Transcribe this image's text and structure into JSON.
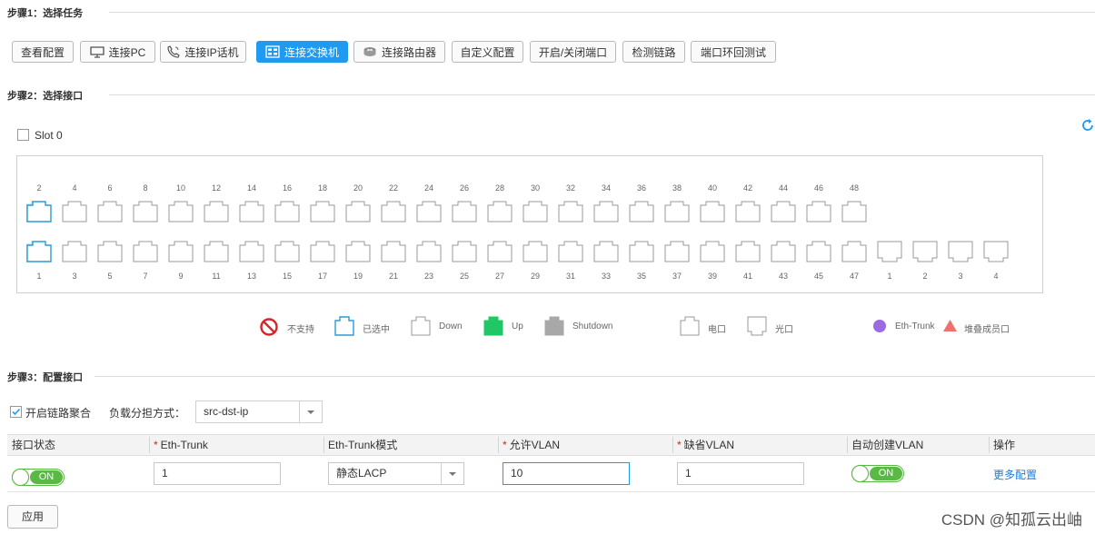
{
  "step1": {
    "title": "步骤1：选择任务",
    "tasks": [
      {
        "label": "查看配置",
        "icon": "",
        "active": false
      },
      {
        "label": "连接PC",
        "icon": "monitor-icon",
        "active": false
      },
      {
        "label": "连接IP话机",
        "icon": "phone-icon",
        "active": false
      },
      {
        "label": "连接交换机",
        "icon": "switch-icon",
        "active": true
      },
      {
        "label": "连接路由器",
        "icon": "router-icon",
        "active": false
      },
      {
        "label": "自定义配置",
        "icon": "",
        "active": false
      },
      {
        "label": "开启/关闭端口",
        "icon": "",
        "active": false
      },
      {
        "label": "检测链路",
        "icon": "",
        "active": false
      },
      {
        "label": "端口环回测试",
        "icon": "",
        "active": false
      }
    ]
  },
  "step2": {
    "title": "步骤2：选择接口",
    "slot_label": "Slot 0",
    "refresh_icon": "refresh-icon",
    "top_ports": [
      "2",
      "4",
      "6",
      "8",
      "10",
      "12",
      "14",
      "16",
      "18",
      "20",
      "22",
      "24",
      "26",
      "28",
      "30",
      "32",
      "34",
      "36",
      "38",
      "40",
      "42",
      "44",
      "46",
      "48"
    ],
    "bottom_ports": [
      "1",
      "3",
      "5",
      "7",
      "9",
      "11",
      "13",
      "15",
      "17",
      "19",
      "21",
      "23",
      "25",
      "27",
      "29",
      "31",
      "33",
      "35",
      "37",
      "39",
      "41",
      "43",
      "45",
      "47"
    ],
    "optical_ports": [
      "1",
      "2",
      "3",
      "4"
    ],
    "selected_ports": [
      "1",
      "2"
    ],
    "legend": {
      "unsupported": "不支持",
      "selected": "已选中",
      "down": "Down",
      "up": "Up",
      "shutdown": "Shutdown",
      "electrical": "电口",
      "optical": "光口",
      "eth_trunk": "Eth-Trunk",
      "stack_member": "堆叠成员口"
    },
    "colors": {
      "selected": "#2e9bd6",
      "up": "#1fc765",
      "shutdown": "#a8a8a8",
      "unsupported": "#d9232d",
      "eth_trunk": "#9b6be0",
      "stack_member": "#f07070"
    }
  },
  "step3": {
    "title": "步骤3：配置接口",
    "enable_aggregation_label": "开启链路聚合",
    "enable_aggregation_checked": true,
    "load_balance_label": "负载分担方式：",
    "load_balance_value": "src-dst-ip",
    "columns": [
      "接口状态",
      "Eth-Trunk",
      "Eth-Trunk模式",
      "允许VLAN",
      "缺省VLAN",
      "自动创建VLAN",
      "操作"
    ],
    "row": {
      "status": "ON",
      "eth_trunk": "1",
      "mode": "静态LACP",
      "allowed_vlan": "10",
      "default_vlan": "1",
      "auto_create_vlan": "ON",
      "action": "更多配置"
    }
  },
  "apply_button": "应用",
  "watermark": "CSDN @知孤云出岫"
}
